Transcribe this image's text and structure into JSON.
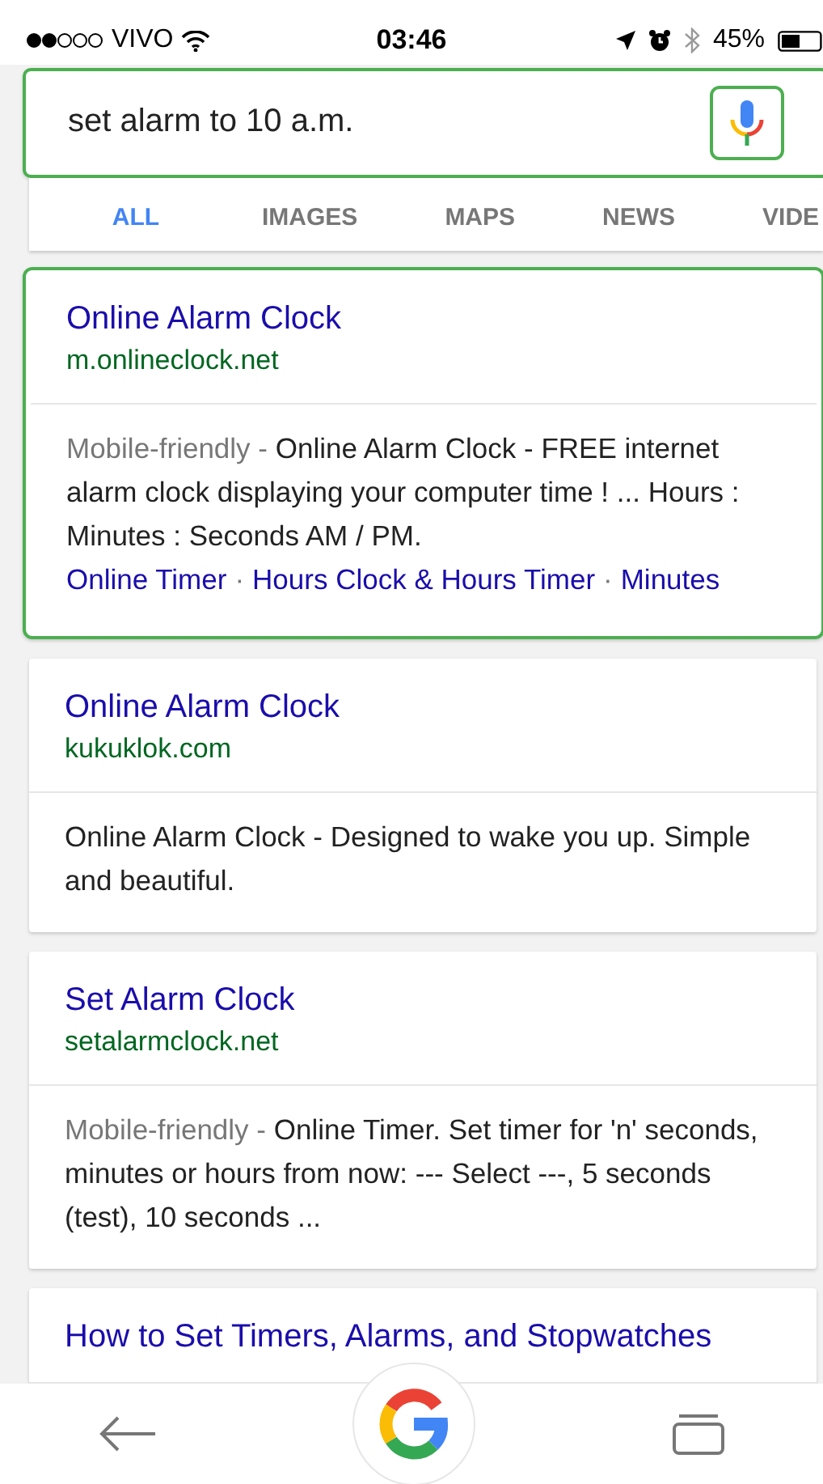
{
  "status_bar": {
    "carrier": "VIVO",
    "time": "03:46",
    "battery": "45%"
  },
  "search": {
    "value": "set alarm to 10 a.m.",
    "highlighted": true,
    "mic_highlighted": true
  },
  "tabs": [
    {
      "label": "ALL",
      "selected": true
    },
    {
      "label": "IMAGES",
      "selected": false
    },
    {
      "label": "MAPS",
      "selected": false
    },
    {
      "label": "NEWS",
      "selected": false
    },
    {
      "label": "VIDE",
      "selected": false
    }
  ],
  "results": [
    {
      "title": "Online Alarm Clock",
      "url": "m.onlineclock.net",
      "highlighted": true,
      "badge": "Mobile-friendly -",
      "snippet": "Online Alarm Clock - FREE internet alarm clock displaying your computer time ! ... Hours : Minutes : Seconds AM / PM.",
      "sitelinks": [
        "Online Timer",
        "Hours Clock & Hours Timer",
        "Minutes"
      ],
      "separator": "·"
    },
    {
      "title": "Online Alarm Clock",
      "url": "kukuklok.com",
      "highlighted": false,
      "snippet": "Online Alarm Clock - Designed to wake you up. Simple and beautiful."
    },
    {
      "title": "Set Alarm Clock",
      "url": "setalarmclock.net",
      "highlighted": false,
      "badge": "Mobile-friendly -",
      "snippet": "Online Timer. Set timer for 'n' seconds, minutes or hours from now: --- Select ---, 5 seconds (test), 10 seconds ..."
    },
    {
      "title": "How to Set Timers, Alarms, and Stopwatches",
      "highlighted": false
    }
  ]
}
